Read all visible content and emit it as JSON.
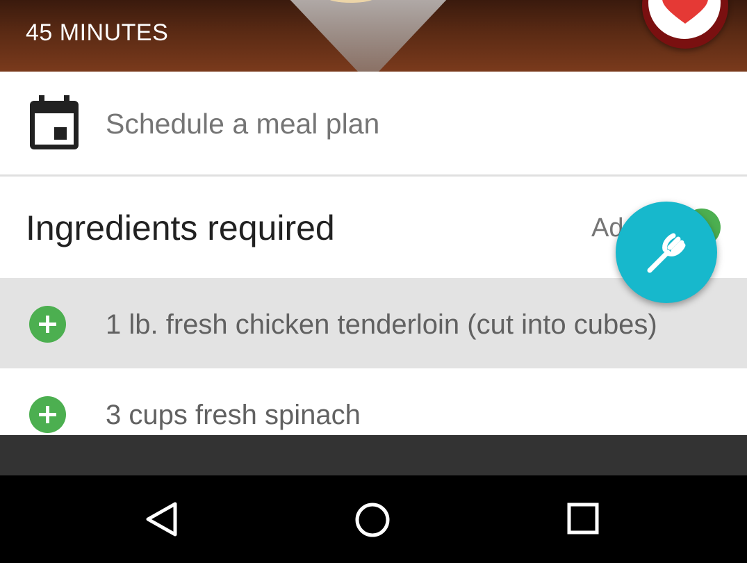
{
  "hero": {
    "time_label": "45 MINUTES",
    "favorite_icon": "heart-icon"
  },
  "schedule": {
    "icon": "calendar-icon",
    "label": "Schedule a meal plan"
  },
  "ingredients": {
    "title": "Ingredients required",
    "add_label": "Ad",
    "items": [
      {
        "icon": "add-circle-icon",
        "text": "1 lb. fresh chicken tenderloin (cut into cubes)",
        "highlighted": true
      },
      {
        "icon": "add-circle-icon",
        "text": "3 cups fresh spinach",
        "highlighted": false
      }
    ]
  },
  "fab": {
    "icon": "fork-icon"
  },
  "navigation": {
    "back_icon": "back-triangle-icon",
    "home_icon": "home-circle-icon",
    "recents_icon": "recents-square-icon"
  },
  "colors": {
    "accent": "#17b8cc",
    "add_green": "#4caf50",
    "favorite_red": "#e53935"
  }
}
